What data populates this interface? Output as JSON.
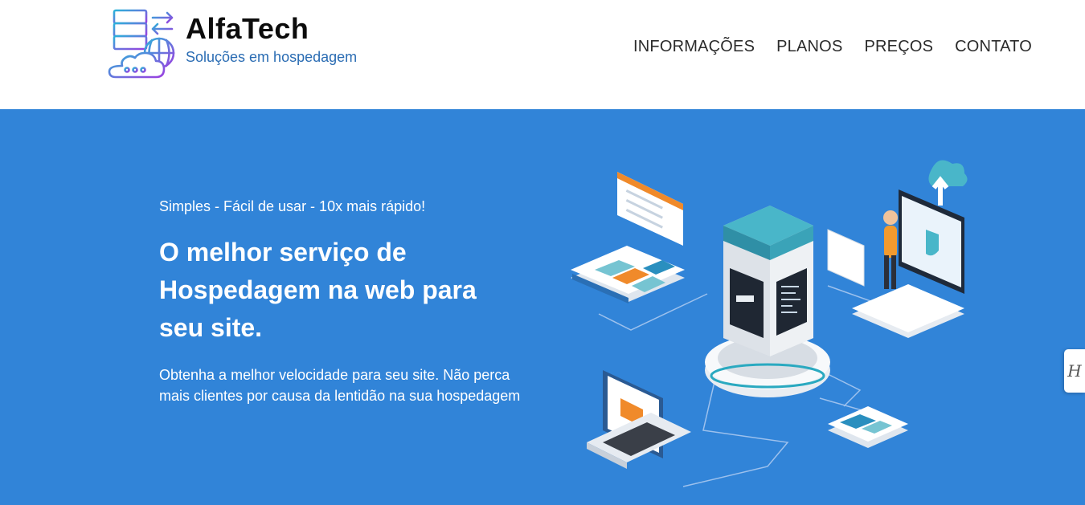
{
  "header": {
    "brand_name": "AlfaTech",
    "brand_tagline": "Soluções em hospedagem",
    "logo_icon": "server-cloud-icon",
    "nav": [
      {
        "label": "INFORMAÇÕES"
      },
      {
        "label": "PLANOS"
      },
      {
        "label": "PREÇOS"
      },
      {
        "label": "CONTATO"
      }
    ]
  },
  "hero": {
    "eyebrow": "Simples - Fácil de usar - 10x mais rápido!",
    "headline": "O melhor serviço de Hospedagem na web para seu site.",
    "description": "Obtenha a melhor velocidade para seu site. Não perca mais clientes por causa da lentidão na sua hospedagem",
    "illustration_icon": "isometric-server-network-illustration"
  },
  "side_tab": {
    "icon": "hostinger-h-icon",
    "glyph": "H"
  },
  "colors": {
    "hero_background": "#3184d8",
    "tagline": "#2a6cb3",
    "brand_text": "#0c0c0c"
  }
}
